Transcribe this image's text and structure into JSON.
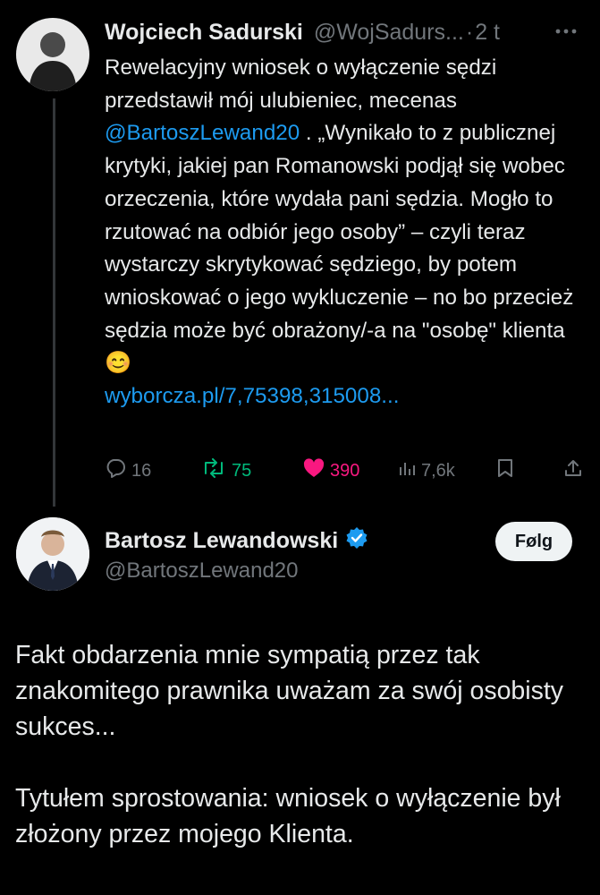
{
  "colors": {
    "background": "#000000",
    "text": "#e7e9ea",
    "muted": "#71767b",
    "link": "#1d9bf0",
    "retweet": "#00ba7c",
    "like": "#f91880",
    "verified": "#1d9bf0"
  },
  "tweet1": {
    "author_name": "Wojciech Sadurski",
    "handle": "@WojSadurs...",
    "separator": "·",
    "time": "2 t",
    "text_part1": "Rewelacyjny wniosek o wyłączenie sędzi przedstawił mój ulubieniec, mecenas ",
    "mention": "@BartoszLewand20",
    "text_part2": " . „Wynikało to z publicznej krytyki, jakiej pan Romanowski podjął się wobec orzeczenia, które wydała pani sędzia. Mogło to rzutować na odbiór jego osoby” – czyli teraz wystarczy skrytykować sędziego, by potem wnioskować o jego wykluczenie – no bo przecież sędzia może być obrażony/-a na \"osobę\" klienta ",
    "emoji": "😊",
    "url": "wyborcza.pl/7,75398,315008...",
    "actions": {
      "replies": "16",
      "retweets": "75",
      "likes": "390",
      "views": "7,6k"
    },
    "icons": [
      "more-icon",
      "reply-icon",
      "retweet-icon",
      "like-icon",
      "views-icon",
      "bookmark-icon",
      "share-icon"
    ]
  },
  "tweet2": {
    "author_name": "Bartosz Lewandowski",
    "handle": "@BartoszLewand20",
    "follow_label": "Følg",
    "paragraph1": "Fakt obdarzenia mnie sympatią przez tak znakomitego prawnika uważam za swój osobisty sukces...",
    "paragraph2": "Tytułem sprostowania: wniosek o wyłączenie był złożony przez mojego Klienta.",
    "icons": [
      "verified-icon"
    ]
  }
}
